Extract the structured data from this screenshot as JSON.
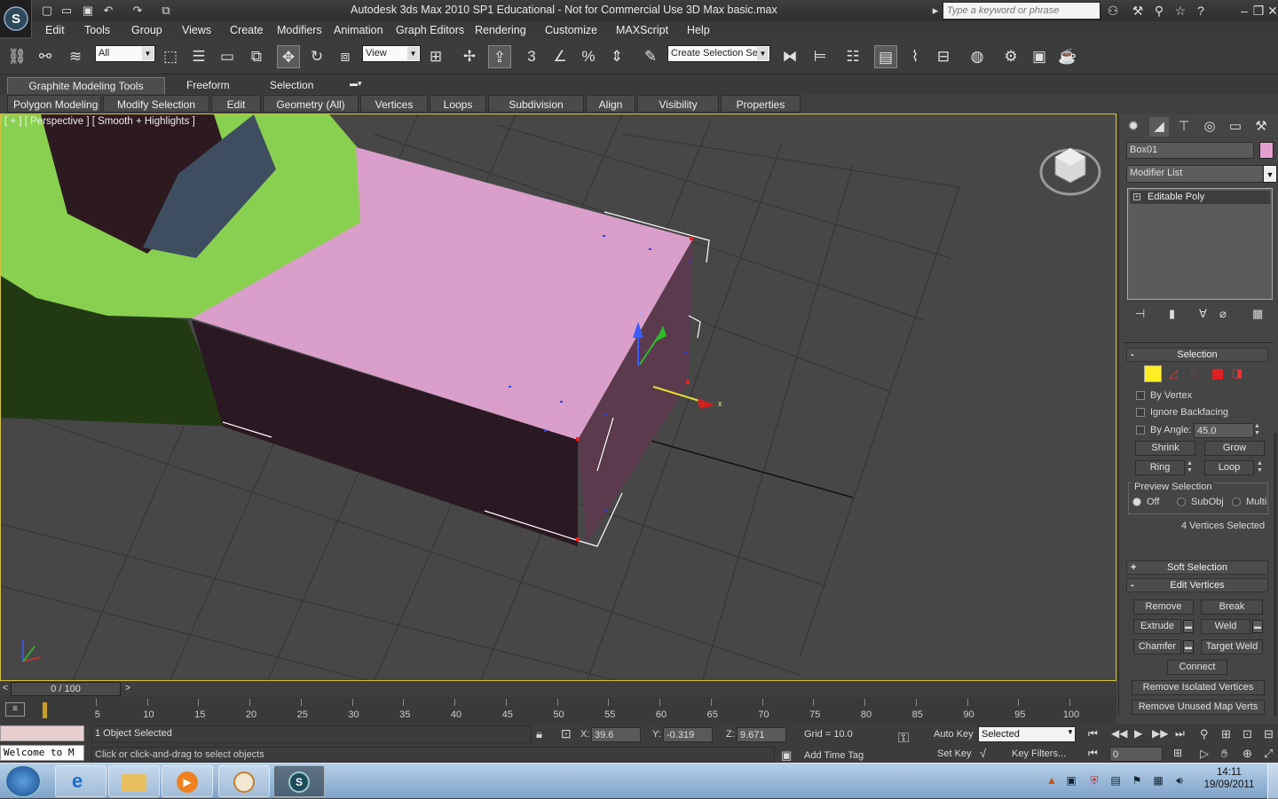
{
  "window": {
    "title": "Autodesk 3ds Max  2010 SP1   Educational - Not for Commercial Use     3D Max basic.max",
    "search_placeholder": "Type a keyword or phrase"
  },
  "quick_access": {
    "icons": [
      "new-icon",
      "open-icon",
      "save-icon",
      "undo-icon",
      "redo-icon",
      "project-icon"
    ]
  },
  "menu": [
    "Edit",
    "Tools",
    "Group",
    "Views",
    "Create",
    "Modifiers",
    "Animation",
    "Graph Editors",
    "Rendering",
    "Customize",
    "MAXScript",
    "Help"
  ],
  "toolbar": {
    "selection_filter": "All",
    "ref_coord": "View",
    "named_selection": "Create Selection Se",
    "snap_label": "3"
  },
  "ribbon": {
    "tabs": [
      "Graphite Modeling Tools",
      "Freeform",
      "Selection"
    ],
    "panels": [
      "Polygon Modeling",
      "Modify Selection",
      "Edit",
      "Geometry (All)",
      "Vertices",
      "Loops",
      "Subdivision",
      "Align",
      "Visibility",
      "Properties"
    ]
  },
  "viewport": {
    "label": "[ + ] [ Perspective ] [ Smooth + Highlights ]"
  },
  "command_panel": {
    "object_name": "Box01",
    "object_color": "#e3a0cf",
    "modifier_list": "Modifier List",
    "stack_item": "Editable Poly",
    "selection": {
      "title": "Selection",
      "by_vertex": "By Vertex",
      "ignore_backfacing": "Ignore Backfacing",
      "by_angle": "By Angle:",
      "angle_value": "45.0",
      "shrink": "Shrink",
      "grow": "Grow",
      "ring": "Ring",
      "loop": "Loop",
      "preview_title": "Preview Selection",
      "preview_options": [
        "Off",
        "SubObj",
        "Multi"
      ],
      "status": "4 Vertices Selected"
    },
    "soft_selection": "Soft Selection",
    "edit_vertices": {
      "title": "Edit Vertices",
      "remove": "Remove",
      "break": "Break",
      "extrude": "Extrude",
      "weld": "Weld",
      "chamfer": "Chamfer",
      "target_weld": "Target Weld",
      "connect": "Connect",
      "remove_isolated": "Remove Isolated Vertices",
      "remove_unused": "Remove Unused Map Verts"
    }
  },
  "timeline": {
    "frame": "0 / 100",
    "ticks": [
      "5",
      "10",
      "15",
      "20",
      "25",
      "30",
      "35",
      "40",
      "45",
      "50",
      "55",
      "60",
      "65",
      "70",
      "75",
      "80",
      "85",
      "90",
      "95",
      "100"
    ],
    "prev": "<",
    "next": ">"
  },
  "status": {
    "listener": "Welcome to M",
    "selected": "1 Object Selected",
    "prompt": "Click or click-and-drag to select objects",
    "x_label": "X:",
    "x": "39.6",
    "y_label": "Y:",
    "y": "-0.319",
    "z_label": "Z:",
    "z": "9.671",
    "grid": "Grid = 10.0",
    "add_time_tag": "Add Time Tag"
  },
  "animation": {
    "auto_key": "Auto Key",
    "set_key": "Set Key",
    "key_mode": "Selected",
    "key_filters": "Key Filters...",
    "frame": "0"
  },
  "taskbar": {
    "time": "14:11",
    "date": "19/09/2011",
    "apps": [
      "start-orb",
      "ie-icon",
      "explorer-icon",
      "media-player-icon",
      "paint-icon",
      "3dsmax-icon"
    ]
  }
}
